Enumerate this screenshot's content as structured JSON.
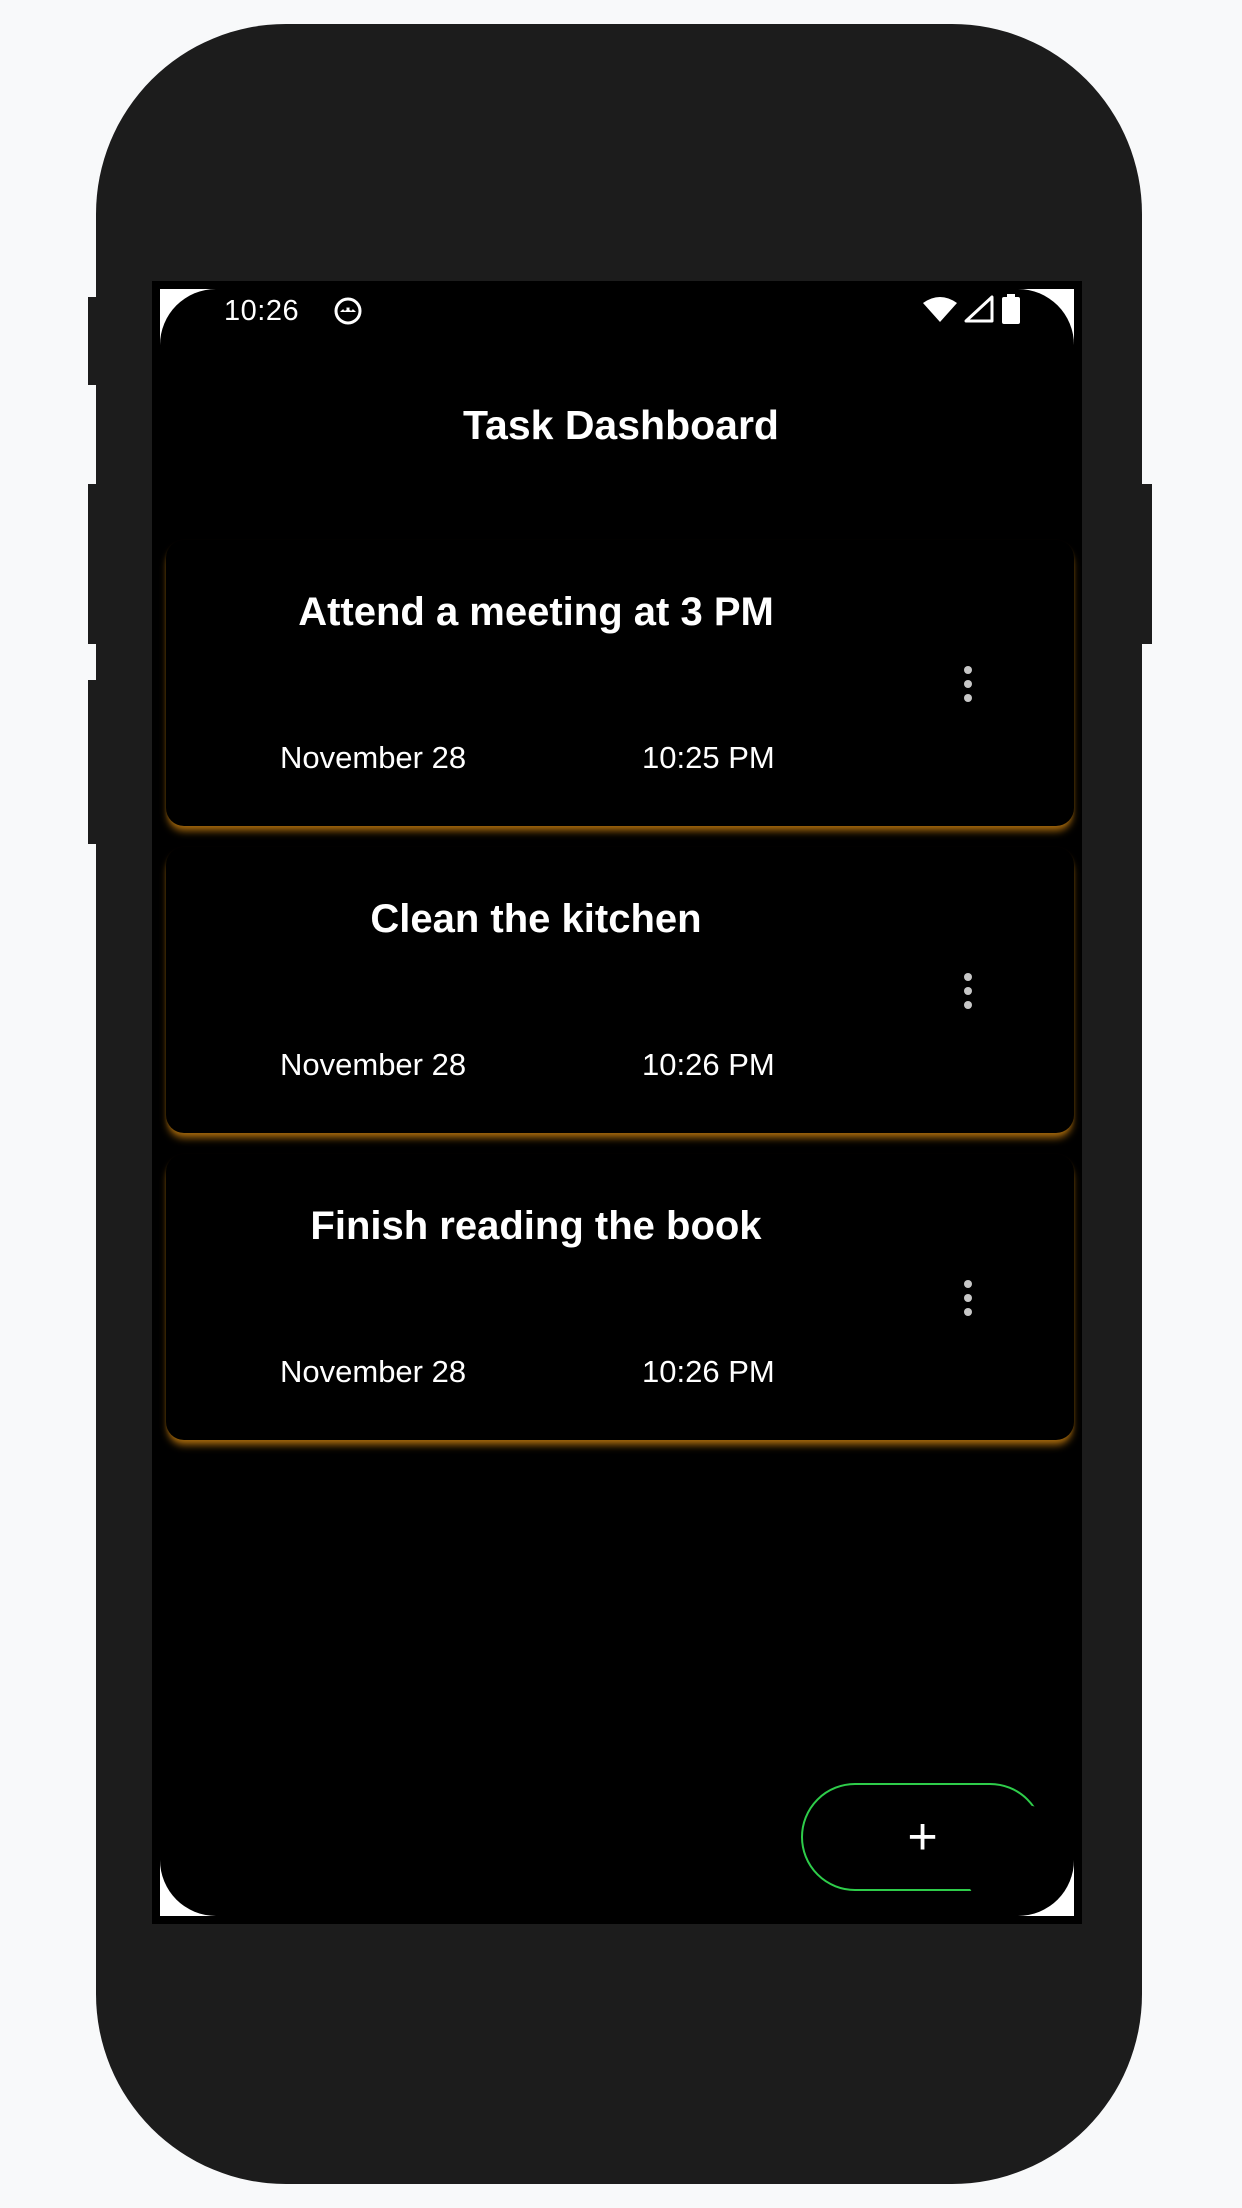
{
  "status_bar": {
    "time": "10:26",
    "app_icon": "android-debug-icon",
    "icons": [
      "wifi-icon",
      "cellular-signal-icon",
      "battery-icon"
    ]
  },
  "header": {
    "title": "Task Dashboard"
  },
  "tasks": [
    {
      "title": "Attend a meeting at 3 PM",
      "date": "November 28",
      "time": "10:25 PM"
    },
    {
      "title": "Clean the kitchen",
      "date": "November 28",
      "time": "10:26 PM"
    },
    {
      "title": "Finish reading the book",
      "date": "November 28",
      "time": "10:26 PM"
    }
  ],
  "fab": {
    "label": "+"
  },
  "colors": {
    "background": "#000000",
    "card_glow": "#b8740e",
    "fab_border": "#2ecc4a",
    "text": "#ffffff",
    "menu_dots": "#c7c7c7"
  }
}
